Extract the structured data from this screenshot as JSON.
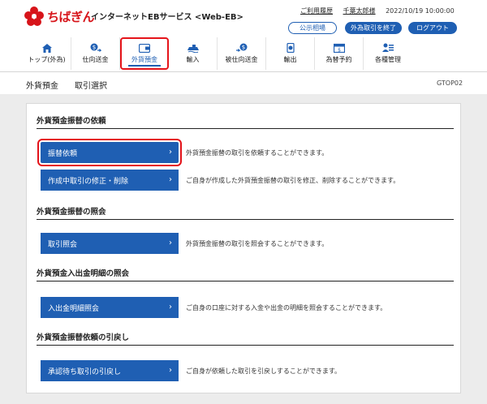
{
  "header": {
    "logo_text": "ちばぎん",
    "service_name": "インターネットEBサービス <Web-EB>",
    "help_link": "ご利用履歴",
    "user_name": "千葉太郎様",
    "datetime": "2022/10/19 10:00:00",
    "btn_rates": "公示相場",
    "btn_fx_exit": "外為取引を終了",
    "btn_logout": "ログアウト"
  },
  "nav": {
    "items": [
      {
        "label": "トップ(外為)",
        "icon": "home-icon"
      },
      {
        "label": "仕向送金",
        "icon": "outward-remit-icon"
      },
      {
        "label": "外貨預金",
        "icon": "deposit-icon"
      },
      {
        "label": "輸入",
        "icon": "import-icon"
      },
      {
        "label": "被仕向送金",
        "icon": "inward-remit-icon"
      },
      {
        "label": "輸出",
        "icon": "export-icon"
      },
      {
        "label": "為替予約",
        "icon": "fx-contract-icon"
      },
      {
        "label": "各種管理",
        "icon": "management-icon"
      }
    ],
    "active_index": 2
  },
  "titlebar": {
    "title": "外貨預金",
    "subtitle": "取引選択",
    "code": "GTOP02"
  },
  "sections": [
    {
      "title": "外貨預金振替の依頼",
      "buttons": [
        {
          "label": "振替依頼",
          "desc": "外貨預金振替の取引を依頼することができます。"
        },
        {
          "label": "作成中取引の修正・削除",
          "desc": "ご自身が作成した外貨預金振替の取引を修正、削除することができます。"
        }
      ]
    },
    {
      "title": "外貨預金振替の照会",
      "buttons": [
        {
          "label": "取引照会",
          "desc": "外貨預金振替の取引を照会することができます。"
        }
      ]
    },
    {
      "title": "外貨預金入出金明細の照会",
      "buttons": [
        {
          "label": "入出金明細照会",
          "desc": "ご自身の口座に対する入金や出金の明細を照会することができます。"
        }
      ]
    },
    {
      "title": "外貨預金振替依頼の引戻し",
      "buttons": [
        {
          "label": "承認待ち取引の引戻し",
          "desc": "ご自身が依頼した取引を引戻しすることができます。"
        }
      ]
    }
  ],
  "colors": {
    "brand_red": "#d7141a",
    "primary_blue": "#1f5fb3",
    "highlight_red": "#e5141a"
  }
}
